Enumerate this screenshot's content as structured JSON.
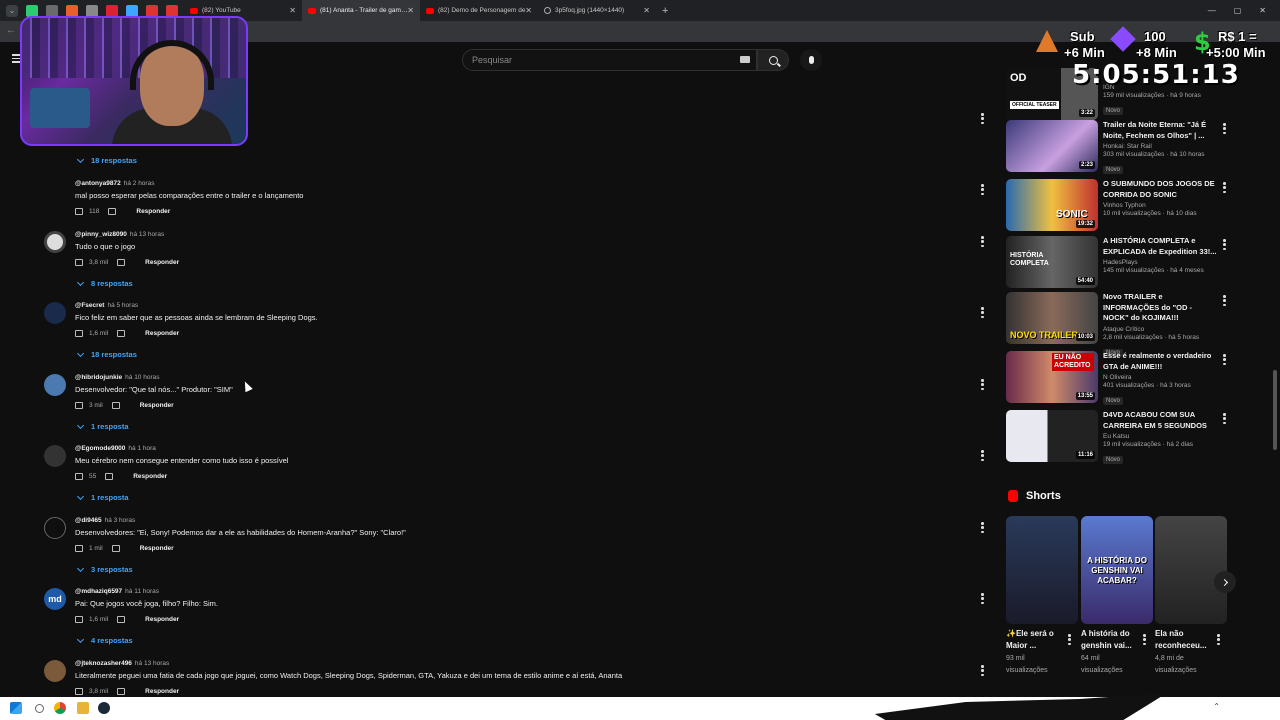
{
  "browser": {
    "tabs": [
      {
        "title": "(82) YouTube",
        "active": false
      },
      {
        "title": "(81) Ananta - Trailer de gamepl",
        "active": true
      },
      {
        "title": "(82) Demo de Personagem de",
        "active": false
      },
      {
        "title": "3p5foq.jpg (1440×1440)",
        "active": false
      }
    ],
    "new_tab": "+"
  },
  "header": {
    "search_placeholder": "Pesquisar"
  },
  "overlay": {
    "sub_label": "Sub",
    "sub_bonus": "+6 Min",
    "gem_count": "100",
    "gem_bonus": "+8 Min",
    "money_label": "R$ 1 =",
    "money_bonus": "+5:00 Min",
    "timer": "5:05:51:13"
  },
  "comments": [
    {
      "type": "replies",
      "label": "18 respostas"
    },
    {
      "author": "@antonya9872",
      "time": "há 2 horas",
      "text": "mal posso esperar pelas comparações entre o trailer e o lançamento",
      "likes": "118",
      "reply": "Responder"
    },
    {
      "author": "@pinny_wiz8090",
      "time": "há 13 horas",
      "text": "Tudo o que o jogo",
      "likes": "3,8 mil",
      "reply": "Responder"
    },
    {
      "type": "replies",
      "label": "8 respostas"
    },
    {
      "author": "@Fsecret",
      "time": "há 5 horas",
      "text": "Fico feliz em saber que as pessoas ainda se lembram de Sleeping Dogs.",
      "likes": "1,6 mil",
      "reply": "Responder"
    },
    {
      "type": "replies",
      "label": "18 respostas"
    },
    {
      "author": "@hibridojunkie",
      "time": "há 10 horas",
      "text": "Desenvolvedor: \"Que tal nós...\" Produtor: \"SIM\"",
      "likes": "3 mil",
      "reply": "Responder"
    },
    {
      "type": "replies",
      "label": "1 resposta"
    },
    {
      "author": "@Egomode9000",
      "time": "há 1 hora",
      "text": "Meu cérebro nem consegue entender como tudo isso é possível",
      "likes": "55",
      "reply": "Responder"
    },
    {
      "type": "replies",
      "label": "1 resposta"
    },
    {
      "author": "@di9465",
      "time": "há 3 horas",
      "text": "Desenvolvedores: \"Ei, Sony! Podemos dar a ele as habilidades do Homem-Aranha?\" Sony: \"Claro!\"",
      "likes": "1 mil",
      "reply": "Responder"
    },
    {
      "type": "replies",
      "label": "3 respostas"
    },
    {
      "author": "@mdhaziq6597",
      "time": "há 11 horas",
      "text": "Pai: Que jogos você joga, filho? Filho: Sim.",
      "likes": "1,6 mil",
      "reply": "Responder",
      "avatar_text": "md"
    },
    {
      "type": "replies",
      "label": "4 respostas"
    },
    {
      "author": "@jteknozasher496",
      "time": "há 13 horas",
      "text": "Literalmente peguei uma fatia de cada jogo que joguei, como Watch Dogs, Sleeping Dogs, Spiderman, GTA, Yakuza e dei um tema de estilo anime e aí está, Ananta",
      "likes": "3,8 mil",
      "reply": "Responder"
    }
  ],
  "related": [
    {
      "thumb_label": "OFFICIAL TEASER",
      "title": "",
      "channel": "IGN",
      "stats": "159 mil visualizações · há 9 horas",
      "badge": "Novo",
      "duration": "3:22"
    },
    {
      "thumb_label": "",
      "title": "Trailer da Noite Eterna: \"Já É Noite, Fechem os Olhos\" | ...",
      "channel": "Honkai: Star Rail",
      "stats": "303 mil visualizações · há 10 horas",
      "badge": "Novo",
      "duration": "2:23"
    },
    {
      "thumb_label": "SONIC",
      "title": "O SUBMUNDO DOS JOGOS DE CORRIDA DO SONIC",
      "channel": "Vinhos Typhon",
      "stats": "10 mil visualizações · há 10 dias",
      "badge": "",
      "duration": "19:32"
    },
    {
      "thumb_label": "HISTÓRIA COMPLETA",
      "title": "A HISTÓRIA COMPLETA e EXPLICADA de Expedition 33!...",
      "channel": "HadesPlays",
      "stats": "145 mil visualizações · há 4 meses",
      "badge": "",
      "duration": "54:40"
    },
    {
      "thumb_label": "NOVO TRAILER",
      "title": "Novo TRAILER e INFORMAÇÕES do \"OD - NOCK\" do KOJIMA!!!",
      "channel": "Ataque Crítico",
      "stats": "2,8 mil visualizações · há 5 horas",
      "badge": "Novo",
      "duration": "10:03"
    },
    {
      "thumb_label": "EU NÃO ACREDITO",
      "title": "Esse é realmente o verdadeiro GTA de ANIME!!!",
      "channel": "N Oliveira",
      "stats": "401 visualizações · há 3 horas",
      "badge": "Novo",
      "duration": "13:55"
    },
    {
      "thumb_label": "",
      "title": "D4VD ACABOU COM SUA CARREIRA EM 5 SEGUNDOS",
      "channel": "Eu Katsu",
      "stats": "19 mil visualizações · há 2 dias",
      "badge": "Novo",
      "duration": "11:16"
    }
  ],
  "shorts": {
    "heading": "Shorts",
    "items": [
      {
        "title": "✨Ele será o Maior ...",
        "views": "93 mil visualizações"
      },
      {
        "title": "A história do genshin vai...",
        "views": "64 mil visualizações",
        "thumb_text": "A HISTÓRIA DO GENSHIN VAI ACABAR?"
      },
      {
        "title": "Ela não reconheceu...",
        "views": "4,8 mi de visualizações"
      }
    ]
  },
  "colors": {
    "background": "#0f0f0f",
    "link_blue": "#3ea6ff",
    "brand_red": "#ff0000"
  }
}
